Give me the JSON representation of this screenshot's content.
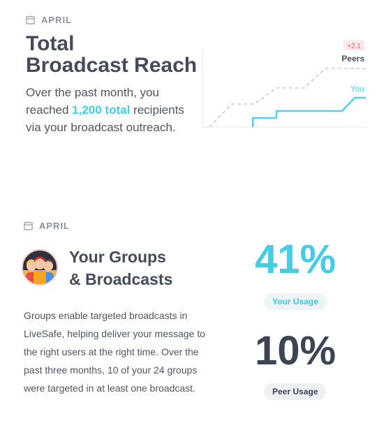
{
  "reach": {
    "section_label": "APRIL",
    "title_line1": "Total",
    "title_line2": "Broadcast Reach",
    "desc_before": "Over the past month, you reached ",
    "desc_highlight": "1,200 total",
    "desc_after": " recipients via your broadcast outreach.",
    "chart_badge": "+2.1",
    "chart_peers_label": "Peers",
    "chart_you_label": "You",
    "colors": {
      "you": "#4fd2e8",
      "peers": "#c8ccd2",
      "badge_bg": "#fde8e8",
      "badge_text": "#e26d6d"
    }
  },
  "groups": {
    "section_label": "APRIL",
    "title_line1": "Your Groups",
    "title_line2": "& Broadcasts",
    "description": "Groups enable targeted broadcasts in LiveSafe, helping deliver your message to the right users at the right time. Over the past three months, 10 of your 24 groups were targeted in at least one broadcast.",
    "your_usage_value": "41%",
    "your_usage_label": "Your Usage",
    "peer_usage_value": "10%",
    "peer_usage_label": "Peer Usage"
  }
}
